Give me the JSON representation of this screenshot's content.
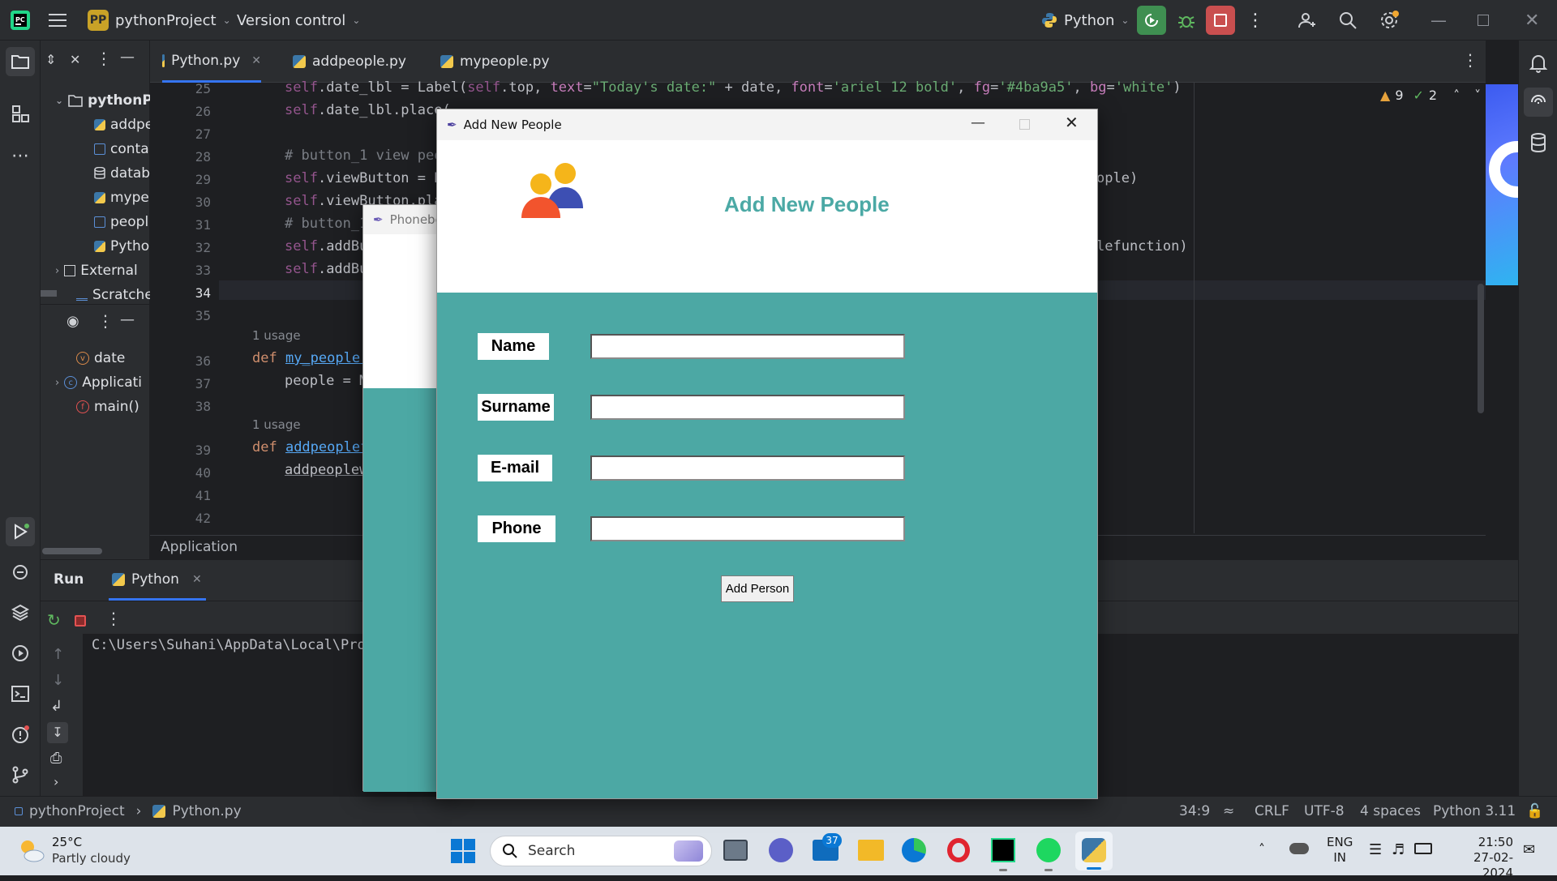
{
  "titlebar": {
    "project_badge": "PP",
    "project_name": "pythonProject",
    "vcs": "Version control",
    "run_config": "Python"
  },
  "project_panel": {
    "root": "pythonP",
    "files": [
      "addpe",
      "conta",
      "datab",
      "mype",
      "peopl",
      "Pytho"
    ],
    "external": "External",
    "scratches": "Scratche"
  },
  "structure": {
    "items": [
      "date",
      "Applicati",
      "main()"
    ]
  },
  "tabs": [
    "Python.py",
    "addpeople.py",
    "mypeople.py"
  ],
  "editor": {
    "line_numbers": [
      "25",
      "26",
      "27",
      "28",
      "29",
      "30",
      "31",
      "32",
      "33",
      "34",
      "35",
      "36",
      "37",
      "38",
      "39",
      "40",
      "41",
      "42"
    ],
    "usage_hint": "1 usage",
    "inspections": {
      "warnings": "9",
      "checks": "2"
    },
    "breadcrumb": "Application",
    "code": {
      "l25_a": "self",
      "l25_b": ".date_lbl = Label(",
      "l25_c": "self",
      "l25_d": ".top, ",
      "l25_e": "text",
      "l25_f": "=",
      "l25_g": "\"Today's date:\"",
      "l25_h": " + date, ",
      "l25_i": "font",
      "l25_j": "=",
      "l25_k": "'ariel 12 bold'",
      "l25_l": ", ",
      "l25_m": "fg",
      "l25_n": "=",
      "l25_o": "'#4ba9a5'",
      "l25_p": ", ",
      "l25_q": "bg",
      "l25_r": "=",
      "l25_s": "'white'",
      "l25_t": ")",
      "l26": ".date_lbl.place(",
      "l28": "# button_1 view peo",
      "l29": ".viewButton = B",
      "l29_tail": "ople)",
      "l30": ".viewButton.pla",
      "l31": "# button_1",
      "l32": ".addBu",
      "l32_tail": "lefunction)",
      "l33": ".addBu",
      "l36_kw": "def ",
      "l36_fn": "my_people(",
      "l37": "people = M",
      "l39_kw": "def ",
      "l39_fn": "addpeoplef",
      "l40": "addpeoplew"
    }
  },
  "run_panel": {
    "title": "Run",
    "tab": "Python",
    "output": "C:\\Users\\Suhani\\AppData\\Local\\Prog"
  },
  "statusbar": {
    "project": "pythonProject",
    "file": "Python.py",
    "position": "34:9",
    "line_sep": "CRLF",
    "encoding": "UTF-8",
    "indent": "4 spaces",
    "interpreter": "Python 3.11"
  },
  "phonebook_window": {
    "title": "Phonebo"
  },
  "add_window": {
    "title": "Add New People",
    "heading": "Add New People",
    "heading_color": "#4ba9a5",
    "body_color": "#4ca8a4",
    "fields": [
      "Name",
      "Surname",
      "E-mail",
      "Phone"
    ],
    "button": "Add Person"
  },
  "taskbar": {
    "weather_temp": "25°C",
    "weather_desc": "Partly cloudy",
    "search_placeholder": "Search",
    "mail_badge": "37",
    "lang_top": "ENG",
    "lang_bottom": "IN",
    "time": "21:50",
    "date": "27-02-2024"
  }
}
